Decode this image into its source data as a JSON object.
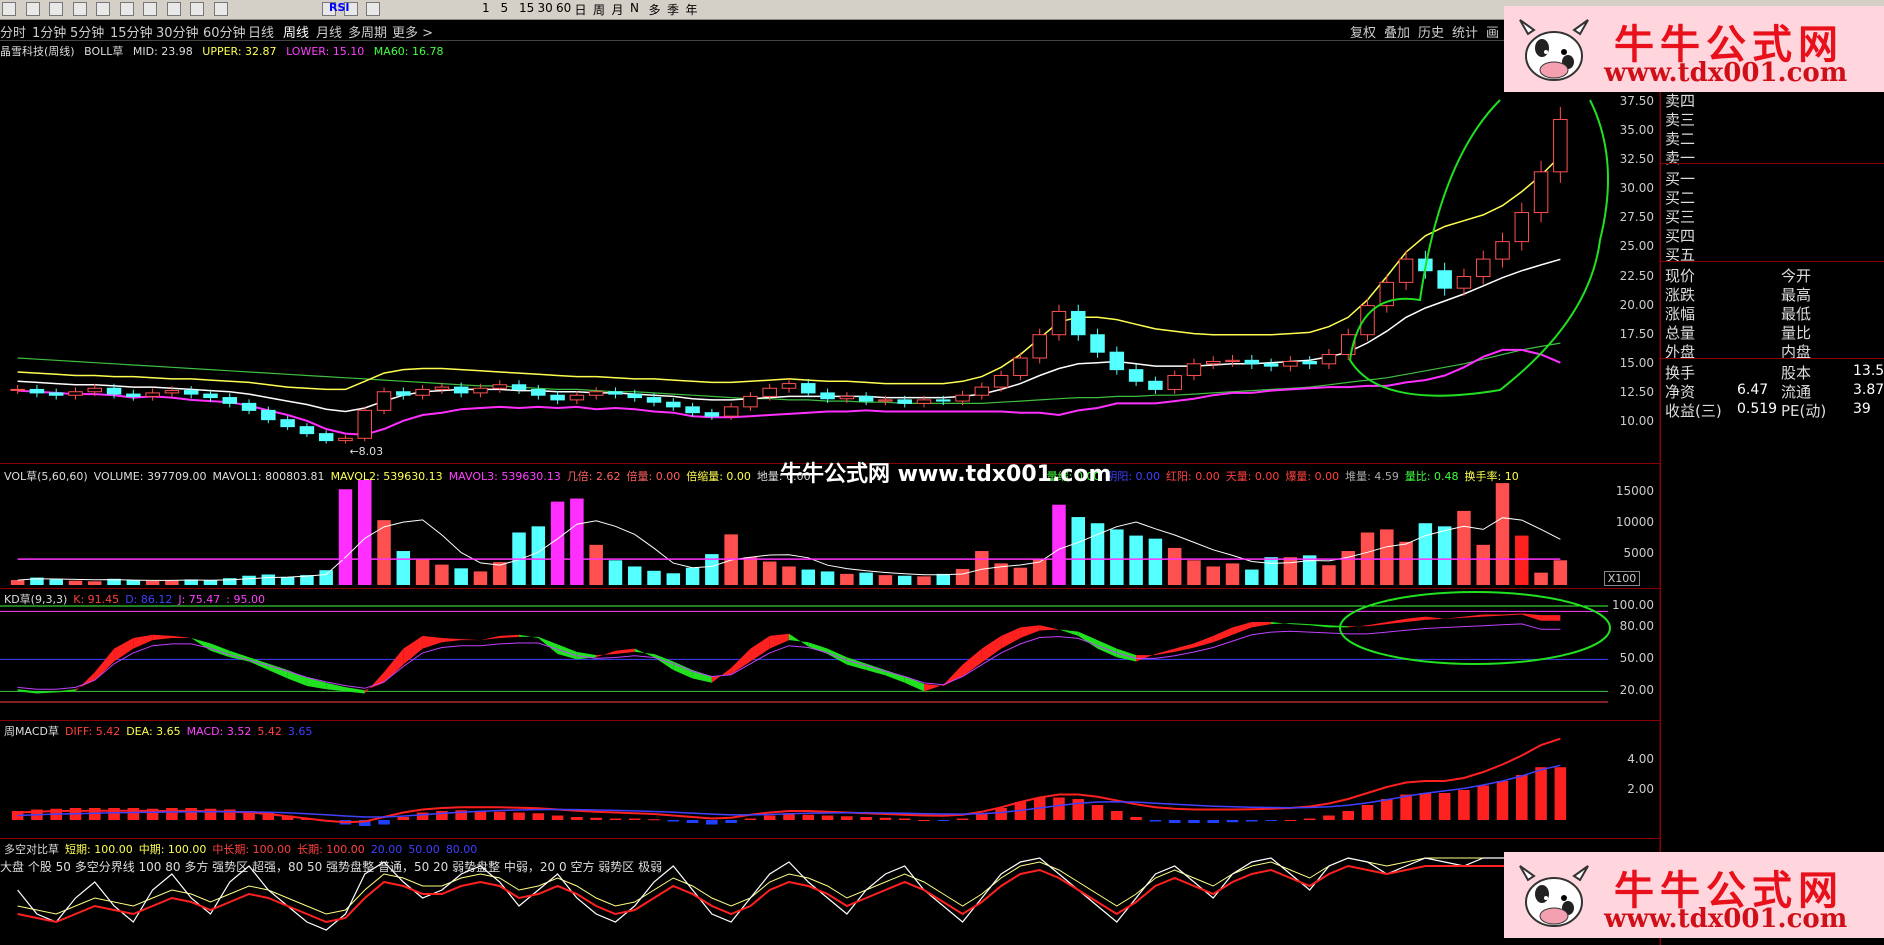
{
  "toolbar": {
    "icons": [
      "record-icon",
      "bar-icon",
      "k-icon",
      "table-icon",
      "cmp-icon",
      "f1-icon",
      "f2-icon",
      "f3-icon",
      "f4-icon",
      "draw-icon",
      "rsi-icon",
      "move-icon",
      "pen-icon",
      "refresh-icon"
    ],
    "rsi_label": "RSI",
    "periods": [
      "1",
      "5",
      "15",
      "30",
      "60",
      "日",
      "周",
      "月",
      "N",
      "多",
      "季",
      "年"
    ]
  },
  "periodbar": {
    "items": [
      "分时",
      "1分钟",
      "5分钟",
      "15分钟",
      "30分钟",
      "60分钟",
      "日线",
      "周线",
      "月线",
      "多周期",
      "更多 >"
    ],
    "active": "周线",
    "right_items": [
      "复权",
      "叠加",
      "历史",
      "统计",
      "画"
    ]
  },
  "main": {
    "stock": "晶雪科技(周线)",
    "indicator": "BOLL草",
    "mid": "MID: 23.98",
    "upper": "UPPER: 32.87",
    "lower": "LOWER: 15.10",
    "ma60": "MA60: 16.78",
    "low_label": "←8.03",
    "yticks": [
      "37.50",
      "35.00",
      "32.50",
      "30.00",
      "27.50",
      "25.00",
      "22.50",
      "20.00",
      "17.50",
      "15.00",
      "12.50",
      "10.00"
    ]
  },
  "vol": {
    "header": [
      "VOL草(5,60,60)",
      "VOLUME: 397709.00",
      "MAVOL1: 800803.81",
      "MAVOL2: 539630.13",
      "MAVOL3: 539630.13",
      "几倍: 2.62",
      "倍量: 0.00",
      "倍缩量: 0.00",
      "地量: 0.00"
    ],
    "header_right": [
      "量缩: 0.00",
      "阴阳: 0.00",
      "红阳: 0.00",
      "天量: 0.00",
      "爆量: 0.00",
      "堆量: 4.59",
      "量比: 0.48",
      "换手率: 10"
    ],
    "yticks": [
      "15000",
      "10000",
      "5000"
    ],
    "unit": "X100"
  },
  "kd": {
    "header": [
      "KD草(9,3,3)",
      "K: 91.45",
      "D: 86.12",
      "J: 75.47",
      ": 95.00"
    ],
    "yticks": [
      "100.00",
      "80.00",
      "50.00",
      "20.00"
    ]
  },
  "macd": {
    "header": [
      "周MACD草",
      "DIFF: 5.42",
      "DEA: 3.65",
      "MACD: 3.52",
      "5.42",
      "3.65"
    ],
    "yticks": [
      "4.00",
      "2.00"
    ]
  },
  "dk": {
    "header": [
      "多空对比草",
      "短期: 100.00",
      "中期: 100.00",
      "中长期: 100.00",
      "长期: 100.00",
      "20.00",
      "50.00",
      "80.00"
    ],
    "note": "大盘 个股 50 多空分界线 100 80 多方 强势区 超强，80 50 强势盘整 普通，50 20 弱势盘整 中弱，20 0 空方 弱势区 极弱"
  },
  "rightpanel": {
    "sell": [
      "卖四",
      "卖三",
      "卖二",
      "卖一"
    ],
    "buy": [
      "买一",
      "买二",
      "买三",
      "买四",
      "买五"
    ],
    "quote_left": [
      "现价",
      "涨跌",
      "涨幅",
      "总量",
      "外盘"
    ],
    "quote_right": [
      "今开",
      "最高",
      "最低",
      "量比",
      "内盘"
    ],
    "fin_left": [
      "换手",
      "净资",
      "收益(三)"
    ],
    "fin_left_vals": [
      "",
      "6.47",
      "0.519"
    ],
    "fin_right": [
      "股本",
      "流通",
      "PE(动)"
    ],
    "fin_right_vals": [
      "13.5",
      "3.87",
      "39"
    ]
  },
  "watermark": {
    "title": "牛牛公式网",
    "url": "www.tdx001.com",
    "center": "牛牛公式网 www.tdx001.com"
  },
  "chart_data": {
    "type": "candlestick",
    "title": "晶雪科技(周线) BOLL草",
    "price_range": [
      8.03,
      37.5
    ],
    "ylim": [
      8,
      39
    ],
    "close": [
      12.8,
      12.5,
      12.3,
      12.6,
      12.9,
      12.4,
      12.2,
      12.5,
      12.7,
      12.4,
      12.1,
      11.6,
      11.0,
      10.2,
      9.6,
      9.0,
      8.4,
      8.6,
      11.0,
      12.6,
      12.3,
      12.8,
      13.0,
      12.5,
      12.9,
      13.2,
      12.8,
      12.3,
      11.9,
      12.3,
      12.6,
      12.4,
      12.1,
      11.7,
      11.3,
      10.8,
      10.5,
      11.3,
      12.2,
      12.9,
      13.3,
      12.5,
      12.0,
      12.2,
      11.8,
      11.9,
      11.6,
      11.9,
      11.8,
      12.3,
      13.0,
      14.0,
      15.5,
      17.5,
      19.5,
      17.5,
      16.0,
      14.5,
      13.5,
      12.8,
      14.0,
      15.0,
      15.2,
      15.3,
      15.0,
      14.8,
      15.2,
      15.0,
      15.8,
      17.5,
      20.0,
      22.0,
      24.0,
      23.0,
      21.5,
      22.5,
      24.0,
      25.5,
      28.0,
      31.5,
      36.0
    ],
    "boll_mid": [
      13.5,
      13.4,
      13.3,
      13.2,
      13.2,
      13.1,
      13.0,
      13.0,
      12.9,
      12.8,
      12.7,
      12.6,
      12.4,
      12.1,
      11.8,
      11.5,
      11.1,
      10.9,
      11.2,
      11.8,
      12.3,
      12.6,
      12.7,
      12.8,
      12.8,
      12.8,
      12.7,
      12.7,
      12.6,
      12.6,
      12.5,
      12.5,
      12.4,
      12.3,
      12.2,
      12.0,
      11.9,
      11.9,
      12.0,
      12.1,
      12.2,
      12.2,
      12.2,
      12.2,
      12.2,
      12.1,
      12.1,
      12.1,
      12.1,
      12.2,
      12.4,
      12.8,
      13.3,
      14.0,
      14.6,
      15.0,
      15.1,
      15.2,
      15.0,
      14.8,
      14.8,
      14.8,
      14.9,
      15.0,
      15.0,
      15.1,
      15.2,
      15.3,
      15.6,
      16.0,
      16.8,
      17.8,
      19.0,
      19.8,
      20.4,
      21.0,
      21.7,
      22.4,
      23.0,
      23.5,
      23.98
    ],
    "boll_upper": [
      14.3,
      14.2,
      14.1,
      14.0,
      14.0,
      13.9,
      13.9,
      13.8,
      13.7,
      13.7,
      13.6,
      13.5,
      13.4,
      13.2,
      13.0,
      12.9,
      12.8,
      12.8,
      13.5,
      14.2,
      14.5,
      14.6,
      14.6,
      14.5,
      14.4,
      14.3,
      14.2,
      14.1,
      14.0,
      13.9,
      13.9,
      13.8,
      13.7,
      13.7,
      13.6,
      13.5,
      13.4,
      13.4,
      13.5,
      13.6,
      13.7,
      13.6,
      13.5,
      13.5,
      13.4,
      13.3,
      13.3,
      13.3,
      13.3,
      13.5,
      13.9,
      14.7,
      15.8,
      17.2,
      18.6,
      19.0,
      19.0,
      18.8,
      18.4,
      18.0,
      17.8,
      17.6,
      17.5,
      17.5,
      17.5,
      17.5,
      17.6,
      17.7,
      18.2,
      19.0,
      20.5,
      22.5,
      24.6,
      26.0,
      26.8,
      27.3,
      27.8,
      28.6,
      29.8,
      31.2,
      32.87
    ],
    "boll_lower": [
      12.7,
      12.6,
      12.5,
      12.4,
      12.4,
      12.3,
      12.1,
      12.2,
      12.1,
      11.9,
      11.8,
      11.7,
      11.4,
      11.0,
      10.6,
      10.1,
      9.4,
      9.0,
      8.9,
      9.4,
      10.1,
      10.6,
      10.8,
      11.1,
      11.2,
      11.3,
      11.2,
      11.3,
      11.2,
      11.3,
      11.1,
      11.2,
      11.1,
      10.9,
      10.8,
      10.5,
      10.4,
      10.4,
      10.5,
      10.6,
      10.7,
      10.8,
      10.9,
      10.9,
      11.0,
      10.9,
      10.9,
      10.9,
      10.9,
      10.9,
      10.9,
      10.9,
      10.8,
      10.8,
      10.6,
      11.0,
      11.2,
      11.6,
      11.6,
      11.6,
      11.8,
      12.0,
      12.3,
      12.5,
      12.5,
      12.7,
      12.8,
      12.9,
      13.0,
      13.0,
      13.1,
      13.1,
      13.4,
      13.6,
      14.0,
      14.7,
      15.6,
      16.2,
      16.2,
      15.8,
      15.1
    ],
    "ma60": [
      15.5,
      15.4,
      15.3,
      15.2,
      15.1,
      15.0,
      14.9,
      14.8,
      14.7,
      14.6,
      14.5,
      14.4,
      14.3,
      14.2,
      14.1,
      14.0,
      13.9,
      13.8,
      13.7,
      13.6,
      13.5,
      13.4,
      13.3,
      13.2,
      13.1,
      13.1,
      13.0,
      12.9,
      12.8,
      12.8,
      12.7,
      12.6,
      12.6,
      12.5,
      12.4,
      12.3,
      12.2,
      12.1,
      12.0,
      12.0,
      11.9,
      11.9,
      11.8,
      11.8,
      11.7,
      11.7,
      11.6,
      11.6,
      11.6,
      11.6,
      11.6,
      11.7,
      11.8,
      11.9,
      12.0,
      12.1,
      12.1,
      12.2,
      12.2,
      12.3,
      12.3,
      12.4,
      12.5,
      12.6,
      12.7,
      12.8,
      12.9,
      13.0,
      13.2,
      13.4,
      13.6,
      13.8,
      14.1,
      14.4,
      14.7,
      15.0,
      15.4,
      15.8,
      16.2,
      16.5,
      16.78
    ],
    "volume": [
      800,
      1200,
      900,
      700,
      600,
      1000,
      800,
      650,
      700,
      900,
      800,
      1100,
      1500,
      1700,
      1300,
      1600,
      2400,
      15500,
      17000,
      10500,
      5500,
      4200,
      3300,
      2700,
      2200,
      3700,
      8500,
      9500,
      13500,
      14000,
      6500,
      4000,
      3000,
      2300,
      1900,
      2800,
      5000,
      8200,
      4500,
      3800,
      3000,
      2500,
      2200,
      1800,
      2000,
      1600,
      1500,
      1400,
      1800,
      2600,
      5500,
      3500,
      2800,
      4200,
      13000,
      11000,
      10000,
      9000,
      8000,
      7500,
      6000,
      4000,
      3000,
      3500,
      2500,
      4500,
      4500,
      4800,
      3200,
      5500,
      8500,
      9000,
      7000,
      10000,
      9500,
      12000,
      6500,
      16500,
      8000,
      2000,
      4000
    ],
    "kd_k": [
      20,
      18,
      19,
      20,
      38,
      60,
      70,
      73,
      72,
      70,
      58,
      52,
      48,
      40,
      32,
      25,
      22,
      20,
      18,
      38,
      60,
      72,
      70,
      69,
      68,
      72,
      73,
      70,
      55,
      50,
      52,
      58,
      60,
      52,
      40,
      32,
      28,
      42,
      60,
      72,
      74,
      62,
      55,
      45,
      40,
      35,
      28,
      20,
      26,
      45,
      60,
      72,
      80,
      82,
      78,
      72,
      60,
      52,
      48,
      55,
      60,
      65,
      72,
      80,
      85,
      85,
      83,
      82,
      80,
      80,
      82,
      85,
      88,
      90,
      88,
      90,
      92,
      92,
      93,
      91.45,
      91.45
    ],
    "kd_d": [
      22,
      20,
      20,
      22,
      30,
      48,
      60,
      68,
      70,
      70,
      65,
      58,
      52,
      46,
      40,
      33,
      28,
      24,
      21,
      28,
      45,
      60,
      66,
      68,
      68,
      70,
      71,
      71,
      64,
      57,
      54,
      55,
      57,
      55,
      48,
      40,
      34,
      36,
      48,
      60,
      68,
      66,
      60,
      52,
      46,
      40,
      34,
      27,
      25,
      34,
      47,
      60,
      70,
      77,
      78,
      76,
      68,
      60,
      54,
      54,
      57,
      61,
      66,
      73,
      80,
      83,
      84,
      83,
      82,
      81,
      81,
      83,
      85,
      87,
      88,
      89,
      90,
      91,
      92,
      86.12,
      86.12
    ],
    "macd_hist": [
      0.6,
      0.7,
      0.75,
      0.8,
      0.8,
      0.8,
      0.8,
      0.75,
      0.8,
      0.8,
      0.75,
      0.7,
      0.6,
      0.5,
      0.3,
      0.1,
      -0.1,
      -0.3,
      -0.4,
      -0.3,
      0.2,
      0.5,
      0.6,
      0.65,
      0.6,
      0.55,
      0.5,
      0.45,
      0.3,
      0.2,
      0.15,
      0.1,
      0.1,
      0.05,
      -0.1,
      -0.2,
      -0.3,
      -0.2,
      0.1,
      0.3,
      0.4,
      0.35,
      0.3,
      0.25,
      0.2,
      0.15,
      0.1,
      0.0,
      -0.05,
      0.1,
      0.4,
      0.8,
      1.2,
      1.5,
      1.5,
      1.4,
      1.0,
      0.6,
      0.2,
      -0.1,
      -0.2,
      -0.2,
      -0.2,
      -0.15,
      -0.1,
      -0.05,
      0.0,
      0.1,
      0.3,
      0.6,
      1.0,
      1.4,
      1.7,
      1.8,
      1.8,
      2.0,
      2.3,
      2.6,
      3.0,
      3.52,
      3.52
    ],
    "macd_diff": [
      0.5,
      0.55,
      0.6,
      0.6,
      0.62,
      0.62,
      0.62,
      0.6,
      0.6,
      0.6,
      0.58,
      0.55,
      0.5,
      0.4,
      0.25,
      0.1,
      -0.05,
      -0.15,
      -0.1,
      0.2,
      0.5,
      0.7,
      0.8,
      0.85,
      0.85,
      0.85,
      0.82,
      0.78,
      0.7,
      0.62,
      0.55,
      0.5,
      0.45,
      0.4,
      0.3,
      0.2,
      0.1,
      0.15,
      0.35,
      0.5,
      0.6,
      0.6,
      0.55,
      0.5,
      0.45,
      0.4,
      0.35,
      0.3,
      0.28,
      0.35,
      0.55,
      0.85,
      1.2,
      1.5,
      1.7,
      1.7,
      1.55,
      1.3,
      1.05,
      0.85,
      0.75,
      0.7,
      0.7,
      0.7,
      0.72,
      0.75,
      0.8,
      0.9,
      1.1,
      1.4,
      1.8,
      2.2,
      2.5,
      2.6,
      2.6,
      2.8,
      3.2,
      3.7,
      4.3,
      5.0,
      5.42
    ],
    "macd_dea": [
      0.3,
      0.35,
      0.4,
      0.42,
      0.45,
      0.48,
      0.5,
      0.52,
      0.53,
      0.54,
      0.55,
      0.55,
      0.54,
      0.52,
      0.48,
      0.42,
      0.35,
      0.27,
      0.2,
      0.2,
      0.26,
      0.35,
      0.44,
      0.52,
      0.58,
      0.63,
      0.67,
      0.69,
      0.7,
      0.69,
      0.67,
      0.64,
      0.61,
      0.57,
      0.52,
      0.46,
      0.39,
      0.34,
      0.34,
      0.37,
      0.42,
      0.45,
      0.47,
      0.48,
      0.48,
      0.47,
      0.45,
      0.42,
      0.4,
      0.39,
      0.42,
      0.5,
      0.64,
      0.8,
      0.97,
      1.11,
      1.2,
      1.22,
      1.19,
      1.12,
      1.05,
      0.98,
      0.92,
      0.88,
      0.85,
      0.83,
      0.82,
      0.83,
      0.88,
      0.98,
      1.14,
      1.35,
      1.58,
      1.78,
      1.94,
      2.11,
      2.33,
      2.6,
      2.94,
      3.35,
      3.65
    ],
    "dk_short": [
      60,
      30,
      20,
      50,
      70,
      40,
      20,
      60,
      80,
      50,
      30,
      70,
      90,
      60,
      40,
      20,
      10,
      30,
      80,
      95,
      70,
      50,
      60,
      80,
      90,
      70,
      40,
      60,
      80,
      50,
      30,
      20,
      40,
      70,
      90,
      60,
      30,
      20,
      50,
      80,
      95,
      70,
      50,
      30,
      60,
      80,
      90,
      60,
      40,
      20,
      50,
      80,
      95,
      100,
      80,
      60,
      40,
      20,
      50,
      80,
      90,
      70,
      50,
      80,
      95,
      100,
      80,
      60,
      90,
      100,
      95,
      80,
      90,
      100,
      95,
      90,
      100,
      100,
      100,
      100,
      100
    ],
    "dk_mid": [
      40,
      35,
      30,
      40,
      50,
      45,
      40,
      50,
      60,
      55,
      45,
      55,
      65,
      60,
      50,
      40,
      30,
      35,
      60,
      80,
      75,
      65,
      65,
      75,
      80,
      75,
      60,
      65,
      75,
      65,
      50,
      40,
      45,
      60,
      75,
      65,
      50,
      40,
      50,
      70,
      80,
      75,
      65,
      50,
      60,
      70,
      80,
      70,
      55,
      40,
      55,
      75,
      90,
      95,
      85,
      70,
      55,
      40,
      55,
      75,
      85,
      75,
      65,
      80,
      90,
      95,
      85,
      75,
      90,
      100,
      95,
      90,
      95,
      100,
      100,
      100,
      100,
      100,
      100,
      100,
      100
    ]
  }
}
